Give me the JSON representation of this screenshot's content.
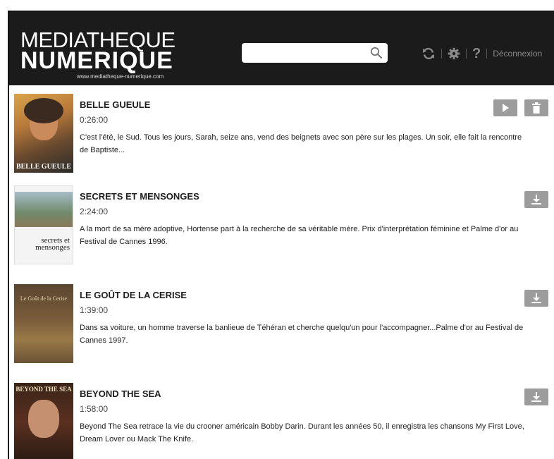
{
  "header": {
    "logo": {
      "line1": "MEDIATHEQUE",
      "line2": "NUMERIQUE",
      "url": "www.mediatheque-numerique.com"
    },
    "search": {
      "value": "",
      "placeholder": ""
    },
    "toolbar": {
      "refresh_icon": "refresh-icon",
      "settings_icon": "gear-icon",
      "help_label": "?",
      "logout_label": "Déconnexion"
    }
  },
  "items": [
    {
      "title": "BELLE GUEULE",
      "duration": "0:26:00",
      "description": "C'est l'été, le Sud. Tous les jours, Sarah, seize ans, vend des beignets avec son père sur les plages. Un soir, elle fait la rencontre de Baptiste...",
      "poster_text": "BELLE GUEULE",
      "actions": [
        "play",
        "delete"
      ]
    },
    {
      "title": "SECRETS ET MENSONGES",
      "duration": "2:24:00",
      "description": "A la mort de sa mère adoptive, Hortense part à la recherche de sa véritable mère. Prix d'interprétation féminine et Palme d'or au Festival de Cannes 1996.",
      "poster_text": "secrets et mensonges",
      "actions": [
        "download"
      ]
    },
    {
      "title": "LE GOÛT DE LA CERISE",
      "duration": "1:39:00",
      "description": "Dans sa voiture, un homme traverse la banlieue de Téhéran et cherche quelqu'un pour l'accompagner...Palme d'or au Festival de Cannes 1997.",
      "poster_text": "Le Goût de la Cerise",
      "actions": [
        "download"
      ]
    },
    {
      "title": "BEYOND THE SEA",
      "duration": "1:58:00",
      "description": "Beyond The Sea retrace la vie du crooner américain Bobby Darin. Durant les années 50, il enregistra les chansons My First Love, Dream Lover ou Mack The Knife.",
      "poster_text": "BEYOND THE SEA",
      "actions": [
        "download"
      ]
    }
  ],
  "colors": {
    "header_bg": "#1b1b1b",
    "button_bg": "#9c9c9c",
    "text": "#1e1e1e"
  }
}
